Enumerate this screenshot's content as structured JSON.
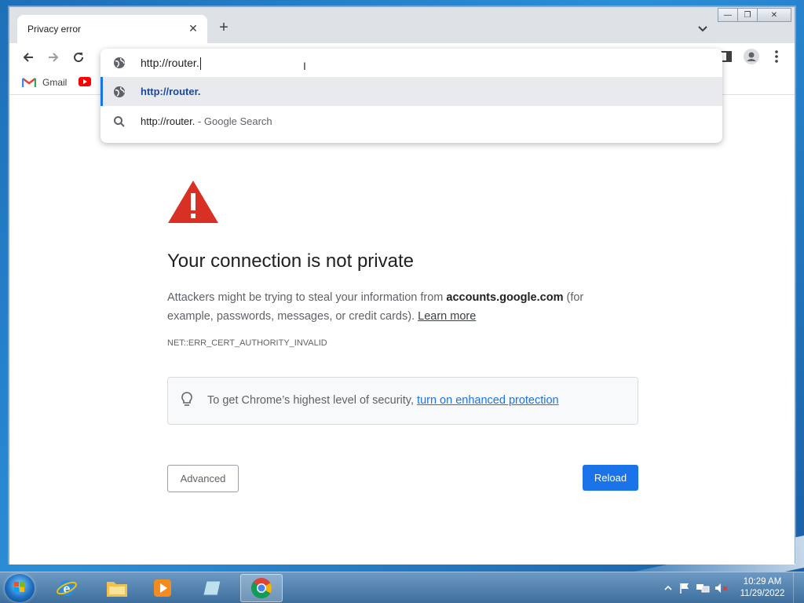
{
  "browser": {
    "tab": {
      "title": "Privacy error"
    },
    "omnibox": {
      "input": "http://router.",
      "suggestions": [
        {
          "text": "http://router.",
          "suffix": "",
          "icon": "globe-icon",
          "selected": true
        },
        {
          "text": "http://router.",
          "suffix": " - Google Search",
          "icon": "search-icon",
          "selected": false
        }
      ]
    },
    "bookmarks": [
      {
        "label": "Gmail",
        "icon": "gmail-icon"
      },
      {
        "label": "",
        "icon": "youtube-icon"
      }
    ]
  },
  "page": {
    "headline": "Your connection is not private",
    "explanation_pre": "Attackers might be trying to steal your information from ",
    "explanation_host": "accounts.google.com",
    "explanation_post": " (for example, passwords, messages, or credit cards). ",
    "learn_more": "Learn more",
    "error_code": "NET::ERR_CERT_AUTHORITY_INVALID",
    "enhanced_text": "To get Chrome’s highest level of security, ",
    "enhanced_link": "turn on enhanced protection",
    "advanced_label": "Advanced",
    "reload_label": "Reload"
  },
  "taskbar": {
    "time": "10:29 AM",
    "date": "11/29/2022"
  },
  "colors": {
    "accent": "#1a73e8",
    "warning": "#d93025"
  }
}
